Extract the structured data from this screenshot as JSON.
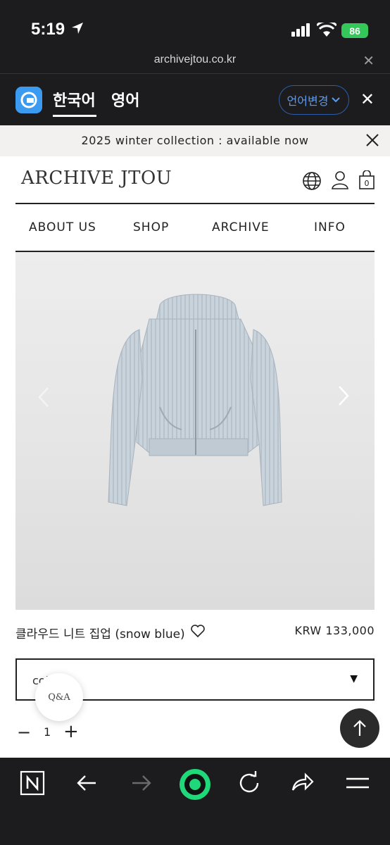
{
  "status": {
    "time": "5:19",
    "battery": "86"
  },
  "browser": {
    "url": "archivejtou.co.kr"
  },
  "translate": {
    "lang_source": "한국어",
    "lang_target": "영어",
    "change_label": "언어변경"
  },
  "announcement": {
    "text": "2025 winter collection : available now"
  },
  "header": {
    "brand": "ARCHIVE JTOU"
  },
  "nav": {
    "items": [
      "ABOUT US",
      "SHOP",
      "ARCHIVE",
      "INFO"
    ]
  },
  "product": {
    "name": "클라우드 니트 집업 (snow blue)",
    "price": "KRW 133,000"
  },
  "option": {
    "label": "col"
  },
  "qa": {
    "label": "Q&A"
  },
  "quantity": {
    "value": "1"
  },
  "colors": {
    "browser_bg": "#1c1c1e",
    "accent": "#3b9bf0",
    "nav_green": "#1fd87a",
    "battery": "#34c759"
  }
}
